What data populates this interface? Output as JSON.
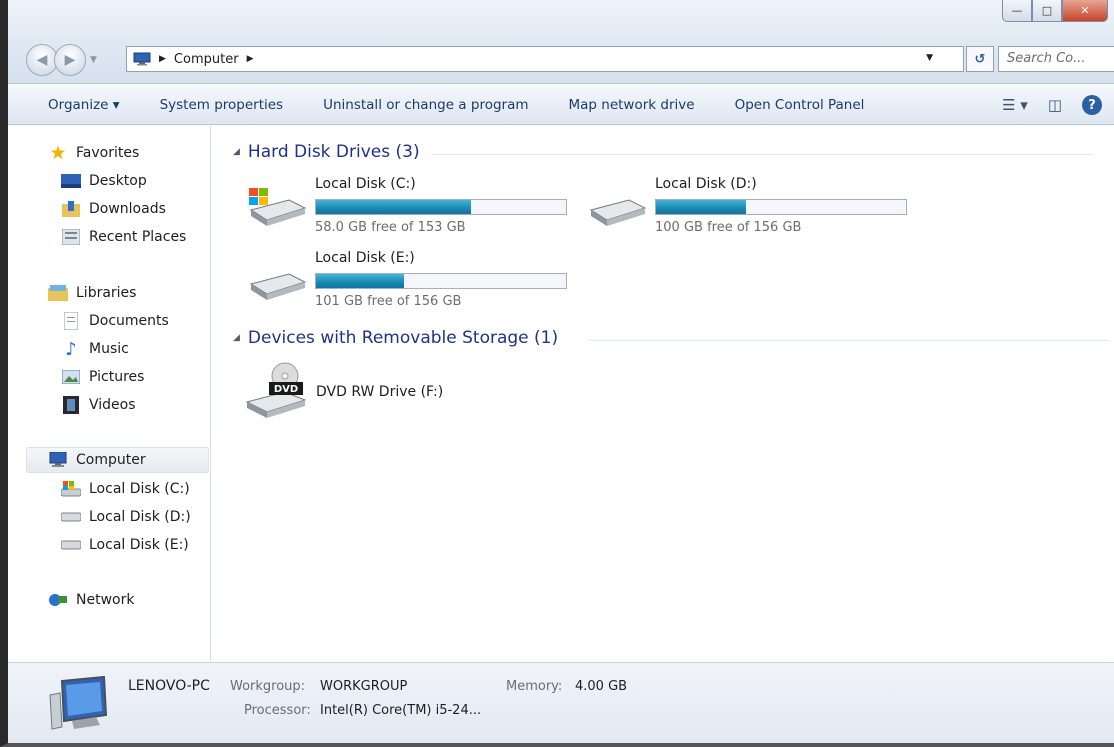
{
  "address": {
    "crumb": "Computer",
    "search_placeholder": "Search Co..."
  },
  "toolbar": {
    "organize": "Organize",
    "system_properties": "System properties",
    "uninstall": "Uninstall or change a program",
    "map_drive": "Map network drive",
    "control_panel": "Open Control Panel"
  },
  "sidebar": {
    "favorites": "Favorites",
    "desktop": "Desktop",
    "downloads": "Downloads",
    "recent_places": "Recent Places",
    "libraries": "Libraries",
    "documents": "Documents",
    "music": "Music",
    "pictures": "Pictures",
    "videos": "Videos",
    "computer": "Computer",
    "disk_c": "Local Disk (C:)",
    "disk_d": "Local Disk (D:)",
    "disk_e": "Local Disk (E:)",
    "network": "Network"
  },
  "groups": {
    "hdd": "Hard Disk Drives (3)",
    "removable": "Devices with Removable Storage (1)"
  },
  "drives": [
    {
      "name": "Local Disk (C:)",
      "free": "58.0 GB free of 153 GB",
      "used_fraction": 0.62,
      "os": true
    },
    {
      "name": "Local Disk (D:)",
      "free": "100 GB free of 156 GB",
      "used_fraction": 0.36,
      "os": false
    },
    {
      "name": "Local Disk (E:)",
      "free": "101 GB free of 156 GB",
      "used_fraction": 0.35,
      "os": false
    }
  ],
  "dvd": {
    "name": "DVD RW Drive (F:)",
    "badge": "DVD"
  },
  "details": {
    "pc_name": "LENOVO-PC",
    "workgroup_label": "Workgroup:",
    "workgroup_value": "WORKGROUP",
    "memory_label": "Memory:",
    "memory_value": "4.00 GB",
    "processor_label": "Processor:",
    "processor_value": "Intel(R) Core(TM) i5-24..."
  },
  "colors": {
    "accent": "#1e3287",
    "bar_fill": "#1c8bb6",
    "link": "#1d3b63"
  }
}
